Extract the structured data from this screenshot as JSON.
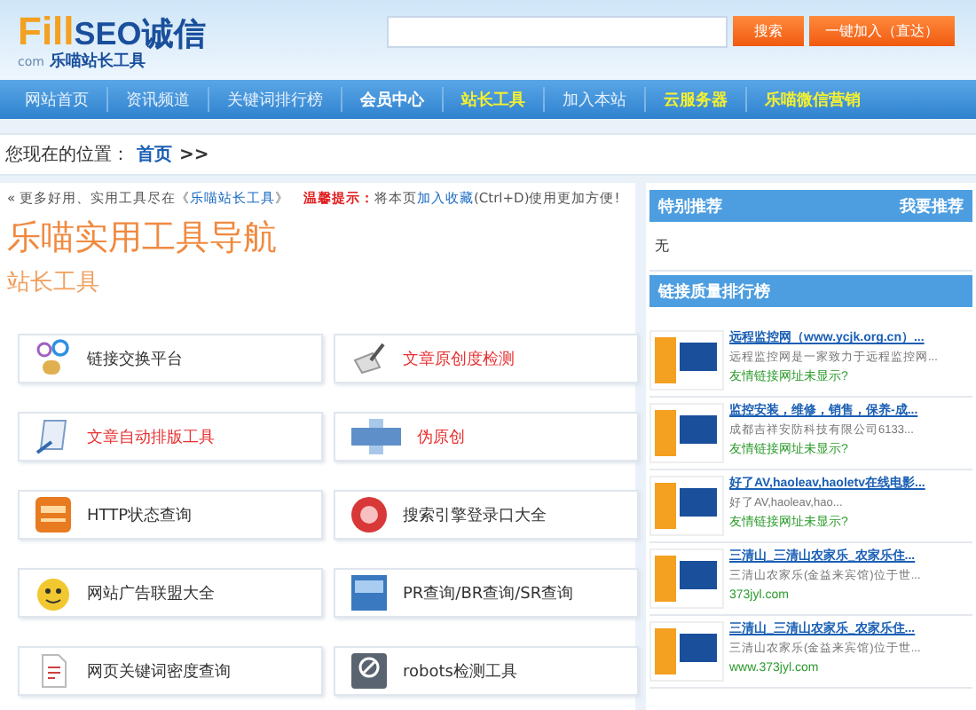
{
  "header": {
    "logo": {
      "brand": "Fill",
      "seo": "SEO诚信",
      "domain": "com",
      "tagline": "乐喵站长工具"
    },
    "search": {
      "button": "搜索",
      "add_button": "一键加入（直达）"
    }
  },
  "nav": [
    {
      "label": "网站首页",
      "kind": "normal"
    },
    {
      "label": "资讯频道",
      "kind": "normal"
    },
    {
      "label": "关键词排行榜",
      "kind": "normal"
    },
    {
      "label": "会员中心",
      "kind": "bold"
    },
    {
      "label": "站长工具",
      "kind": "highlight"
    },
    {
      "label": "加入本站",
      "kind": "normal"
    },
    {
      "label": "云服务器",
      "kind": "highlight"
    },
    {
      "label": "乐喵微信营销",
      "kind": "highlight"
    }
  ],
  "breadcrumb": {
    "label": "您现在的位置：",
    "home": "首页",
    "sep": ">>"
  },
  "notice": {
    "prefix": "« 更多好用、实用工具尽在《",
    "link": "乐喵站长工具",
    "suffix": "》",
    "tip_label": "温馨提示：",
    "tip_text": "将本页",
    "tip_link": "加入收藏",
    "tip_end": "(Ctrl+D)使用更加方便!"
  },
  "title": "乐喵实用工具导航",
  "subtitle": "站长工具",
  "tools": [
    {
      "label": "链接交换平台",
      "highlight": false
    },
    {
      "label": "文章原创度检测",
      "highlight": true
    },
    {
      "label": "文章自动排版工具",
      "highlight": true
    },
    {
      "label": "伪原创",
      "highlight": true
    },
    {
      "label": "HTTP状态查询",
      "highlight": false
    },
    {
      "label": "搜索引擎登录口大全",
      "highlight": false
    },
    {
      "label": "网站广告联盟大全",
      "highlight": false
    },
    {
      "label": "PR查询/BR查询/SR查询",
      "highlight": false
    },
    {
      "label": "网页关键词密度查询",
      "highlight": false
    },
    {
      "label": "robots检测工具",
      "highlight": false
    }
  ],
  "sidebar": {
    "special": {
      "title": "特别推荐",
      "action": "我要推荐",
      "body": "无"
    },
    "ranking": {
      "title": "链接质量排行榜",
      "items": [
        {
          "title": "远程监控网（www.ycjk.org.cn）...",
          "desc": "远程监控网是一家致力于远程监控网...",
          "url": "友情链接网址未显示?"
        },
        {
          "title": "监控安装，维修，销售，保养-成...",
          "desc": "成都吉祥安防科技有限公司6133...",
          "url": "友情链接网址未显示?"
        },
        {
          "title": "好了AV,haoleav,haoletv在线电影...",
          "desc": "好了AV,haoleav,hao...",
          "url": "友情链接网址未显示?"
        },
        {
          "title": "三清山_三清山农家乐_农家乐住...",
          "desc": "三清山农家乐(金益来宾馆)位于世...",
          "url": "373jyl.com"
        },
        {
          "title": "三清山_三清山农家乐_农家乐住...",
          "desc": "三清山农家乐(金益来宾馆)位于世...",
          "url": "www.373jyl.com"
        }
      ]
    }
  }
}
